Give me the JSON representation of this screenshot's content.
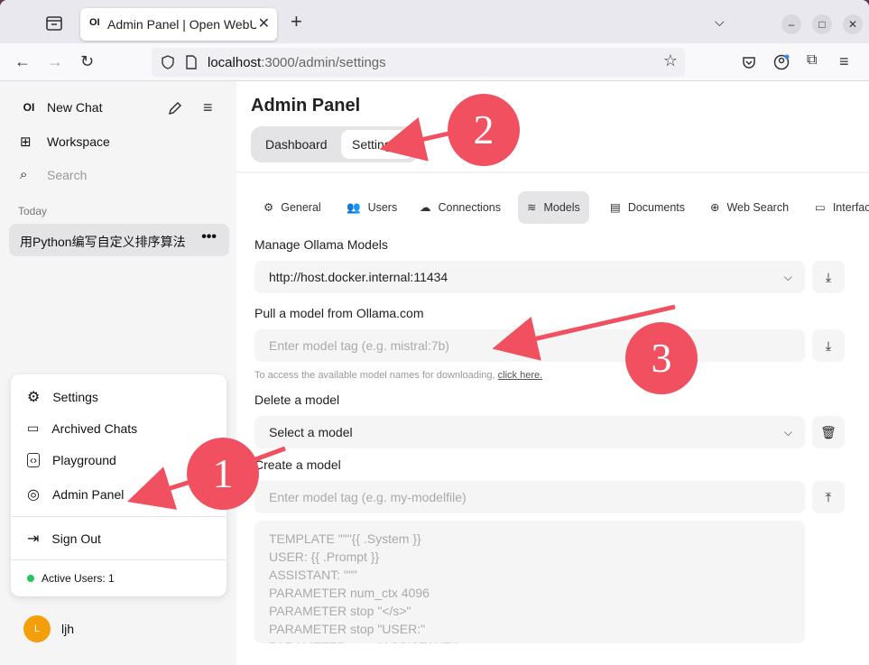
{
  "browser": {
    "tab_title": "Admin Panel | Open WebUI",
    "tab_favicon": "OI",
    "url_host": "localhost",
    "url_rest": ":3000/admin/settings"
  },
  "sidebar": {
    "logo": "OI",
    "new_chat": "New Chat",
    "workspace": "Workspace",
    "search_placeholder": "Search",
    "section_today": "Today",
    "chat_title": "用Python编写自定义排序算法",
    "chat_more": "•••",
    "menu": {
      "settings": "Settings",
      "archived_chats": "Archived Chats",
      "playground": "Playground",
      "admin_panel": "Admin Panel",
      "sign_out": "Sign Out",
      "active_users": "Active Users: 1"
    },
    "user": {
      "initial": "L",
      "name": "ljh"
    }
  },
  "main": {
    "title": "Admin Panel",
    "segments": [
      "Dashboard",
      "Settings"
    ],
    "tabs": [
      "General",
      "Users",
      "Connections",
      "Models",
      "Documents",
      "Web Search",
      "Interface"
    ],
    "manage_label": "Manage Ollama Models",
    "ollama_url": "http://host.docker.internal:11434",
    "pull_label": "Pull a model from Ollama.com",
    "pull_placeholder": "Enter model tag (e.g. mistral:7b)",
    "hint_text": "To access the available model names for downloading, ",
    "hint_link": "click here.",
    "delete_label": "Delete a model",
    "delete_select": "Select a model",
    "create_label": "Create a model",
    "create_placeholder": "Enter model tag (e.g. my-modelfile)",
    "modelfile_placeholder": "TEMPLATE \"\"\"{{ .System }}\nUSER: {{ .Prompt }}\nASSISTANT: \"\"\"\nPARAMETER num_ctx 4096\nPARAMETER stop \"</s>\"\nPARAMETER stop \"USER:\"\nPARAMETER stop \"ASSISTANT:\""
  },
  "annotations": [
    "1",
    "2",
    "3"
  ],
  "colors": {
    "annotation": "#f0505f",
    "active_dot": "#22c55e",
    "avatar": "#f59e0b"
  }
}
